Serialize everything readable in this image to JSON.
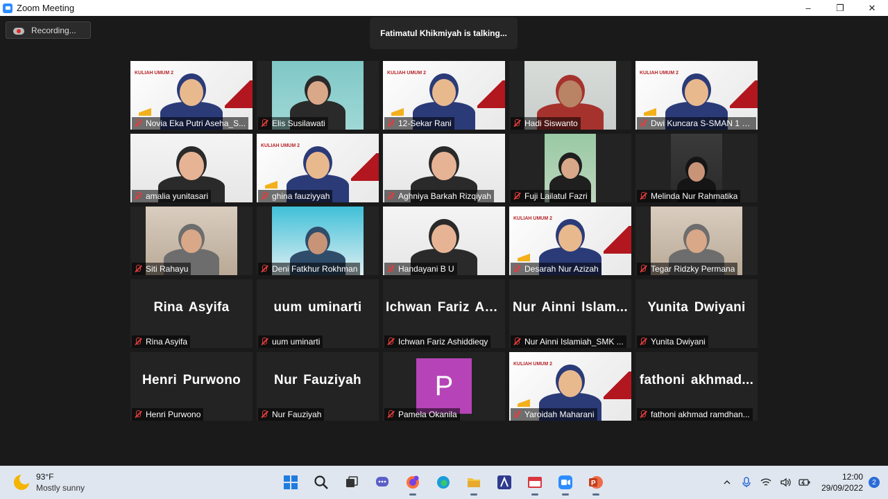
{
  "window": {
    "title": "Zoom Meeting",
    "controls": {
      "minimize": "–",
      "maximize": "❐",
      "close": "✕"
    }
  },
  "meeting": {
    "recording_label": "Recording...",
    "talking_banner": "Fatimatul Khikmiyah is talking..."
  },
  "participants": [
    {
      "name": "Novia Eka Putri Aseha_S...",
      "video": "slide"
    },
    {
      "name": "Elis Susilawati",
      "video": "teal"
    },
    {
      "name": "12-Sekar Rani",
      "video": "slide"
    },
    {
      "name": "Hadi Siswanto",
      "video": "wall"
    },
    {
      "name": "Dwi Kuncara S-SMAN 1 K...",
      "video": "slide"
    },
    {
      "name": "amalia yunitasari",
      "video": "white"
    },
    {
      "name": "ghina fauziyyah",
      "video": "slide"
    },
    {
      "name": "Aghniya Barkah Rizqiyah",
      "video": "white"
    },
    {
      "name": "Fuji Lailatul Fazri",
      "video": "green"
    },
    {
      "name": "Melinda Nur Rahmatika",
      "video": "dark"
    },
    {
      "name": "Siti Rahayu",
      "video": "room"
    },
    {
      "name": "Deni Fatkhur Rokhman",
      "video": "cyan"
    },
    {
      "name": "Handayani B U",
      "video": "white"
    },
    {
      "name": "Desarah Nur Azizah",
      "video": "slide"
    },
    {
      "name": "Tegar Ridzky Permana",
      "video": "room"
    },
    {
      "name": "Rina Asyifa",
      "display_name": "Rina Asyifa"
    },
    {
      "name": "uum uminarti",
      "display_name": "uum uminarti"
    },
    {
      "name": "Ichwan Fariz Ashiddieqy",
      "display_name": "Ichwan Fariz As..."
    },
    {
      "name": "Nur Ainni Islamiah_SMK ...",
      "display_name": "Nur Ainni Islam..."
    },
    {
      "name": "Yunita Dwiyani",
      "display_name": "Yunita Dwiyani"
    },
    {
      "name": "Henri Purwono",
      "display_name": "Henri Purwono"
    },
    {
      "name": "Nur Fauziyah",
      "display_name": "Nur Fauziyah"
    },
    {
      "name": "Pamela Okanila",
      "avatar_letter": "P",
      "avatar_color": "#b644b8"
    },
    {
      "name": "Yaroidah Maharani",
      "video": "slide"
    },
    {
      "name": "fathoni akhmad ramdhan...",
      "display_name": "fathoni akhmad..."
    }
  ],
  "slide": {
    "title": "KULIAH UMUM 2"
  },
  "taskbar": {
    "weather": {
      "temp": "93°F",
      "condition": "Mostly sunny"
    },
    "apps": [
      "start",
      "search",
      "task-view",
      "chat",
      "firefox",
      "edge",
      "file-explorer",
      "app-a",
      "spss",
      "zoom",
      "powerpoint"
    ],
    "clock": {
      "time": "12:00",
      "date": "29/09/2022"
    },
    "notifications": "2"
  }
}
